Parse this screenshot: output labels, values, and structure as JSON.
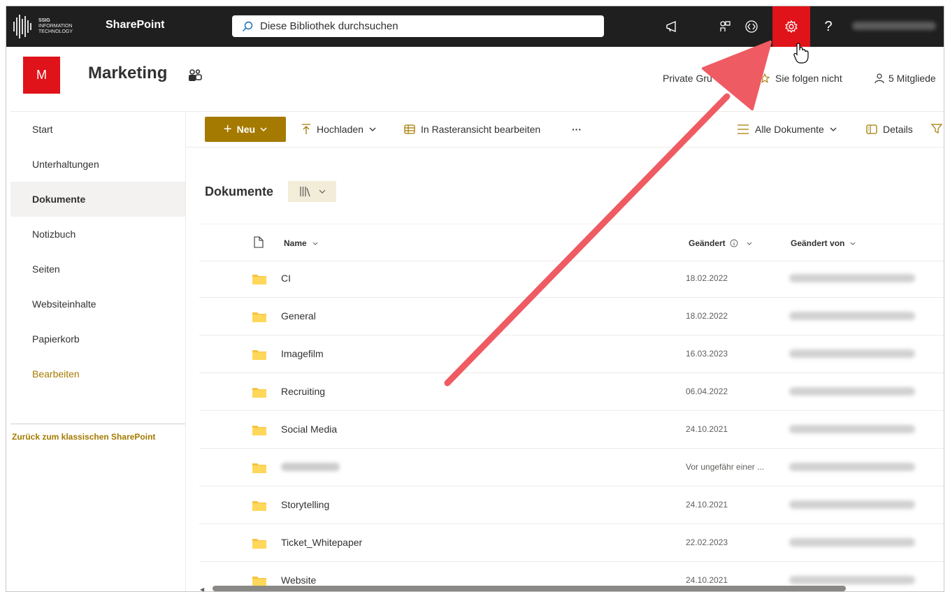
{
  "suitebar": {
    "logo_lines": [
      "SSIG",
      "INFORMATION",
      "TECHNOLOGY"
    ],
    "app_name": "SharePoint",
    "search_placeholder": "Diese Bibliothek durchsuchen",
    "icons": [
      "megaphone-icon",
      "apps-icon",
      "code-icon",
      "gear-icon",
      "help-icon"
    ],
    "help_label": "?",
    "gear_color": "#e0131a"
  },
  "site": {
    "logo_letter": "M",
    "title": "Marketing",
    "privacy": "Private Gru",
    "follow": "Sie folgen nicht",
    "members": "5 Mitgliede"
  },
  "nav": {
    "items": [
      {
        "label": "Start"
      },
      {
        "label": "Unterhaltungen"
      },
      {
        "label": "Dokumente",
        "active": true
      },
      {
        "label": "Notizbuch"
      },
      {
        "label": "Seiten"
      },
      {
        "label": "Websiteinhalte"
      },
      {
        "label": "Papierkorb"
      },
      {
        "label": "Bearbeiten"
      }
    ],
    "classic_link": "Zurück zum klassischen SharePoint"
  },
  "commandbar": {
    "new_label": "Neu",
    "upload_label": "Hochladen",
    "grid_edit_label": "In Rasteransicht bearbeiten",
    "more_label": "···",
    "view_label": "Alle Dokumente",
    "details_label": "Details"
  },
  "library": {
    "title": "Dokumente",
    "columns": {
      "name": "Name",
      "modified": "Geändert",
      "modified_by": "Geändert von"
    },
    "rows": [
      {
        "name": "CI",
        "modified": "18.02.2022"
      },
      {
        "name": "General",
        "modified": "18.02.2022"
      },
      {
        "name": "Imagefilm",
        "modified": "16.03.2023"
      },
      {
        "name": "Recruiting",
        "modified": "06.04.2022"
      },
      {
        "name": "Social Media",
        "modified": "24.10.2021"
      },
      {
        "name": "",
        "modified": "Vor ungefähr einer ..."
      },
      {
        "name": "Storytelling",
        "modified": "24.10.2021"
      },
      {
        "name": "Ticket_Whitepaper",
        "modified": "22.02.2023"
      },
      {
        "name": "Website",
        "modified": "24.10.2021"
      }
    ]
  },
  "colors": {
    "accent": "#a57a00",
    "suitebar": "#1f1f1f",
    "annotation_arrow": "#ef5b62",
    "folder": "#f7c23c"
  }
}
